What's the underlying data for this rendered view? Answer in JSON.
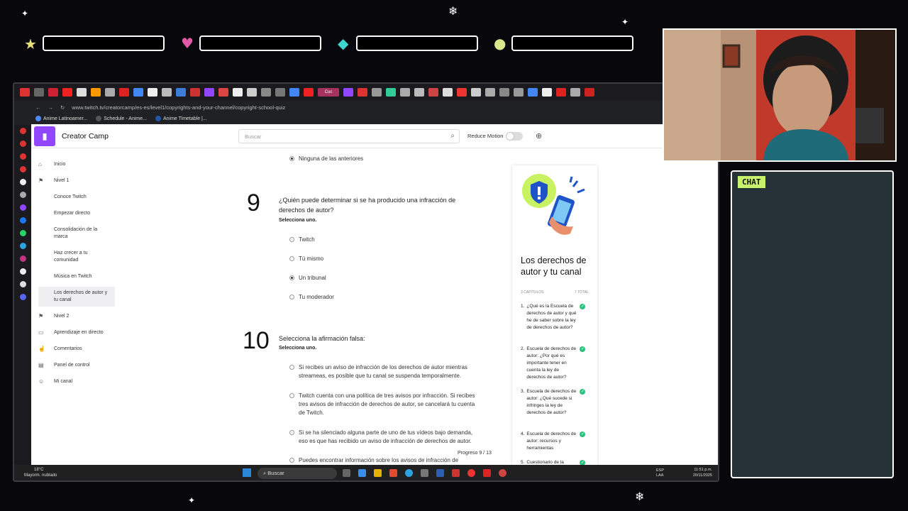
{
  "overlay": {
    "chat_label": "CHAT",
    "icons": [
      "star-icon",
      "heart-icon",
      "diamond-icon",
      "coin-icon"
    ]
  },
  "browser": {
    "url": "www.twitch.tv/creatorcamp/es-es/level1/copyrights-and-your-channel/copyright-school-quiz",
    "active_tab": "Cuc",
    "bookmarks": [
      "Anime Latinoamer...",
      "Schedule - Anime...",
      "Anime Timetable |..."
    ]
  },
  "site": {
    "title": "Creator Camp",
    "search_placeholder": "Buscar",
    "reduce_motion": "Reduce Motion"
  },
  "nav": {
    "items": [
      {
        "label": "Inicio"
      },
      {
        "label": "Nivel 1"
      },
      {
        "label": "Conoce Twitch"
      },
      {
        "label": "Empezar directo"
      },
      {
        "label": "Consolidación de la marca"
      },
      {
        "label": "Haz crecer a tu comunidad"
      },
      {
        "label": "Música en Twitch"
      },
      {
        "label": "Los derechos de autor y tu canal"
      },
      {
        "label": "Nivel 2"
      },
      {
        "label": "Aprendizaje en directo"
      },
      {
        "label": "Comentarios"
      },
      {
        "label": "Panel de control"
      },
      {
        "label": "Mi canal"
      }
    ]
  },
  "quiz": {
    "prev_option": "Ninguna de las anteriores",
    "q9": {
      "number": "9",
      "text": "¿Quién puede determinar si se ha producido una infracción de derechos de autor?",
      "hint": "Selecciona uno.",
      "options": [
        "Twitch",
        "Tú mismo",
        "Un tribunal",
        "Tu moderador"
      ],
      "selected_index": 2
    },
    "q10": {
      "number": "10",
      "text": "Selecciona la afirmación falsa:",
      "hint": "Selecciona uno.",
      "options": [
        "Si recibes un aviso de infracción de los derechos de autor mientras streameas, es posible que tu canal se suspenda temporalmente.",
        "Twitch cuenta con una política de tres avisos por infracción. Si recibes tres avisos de infracción de derechos de autor, se cancelará tu cuenta de Twitch.",
        "Si se ha silenciado alguna parte de uno de tus vídeos bajo demanda, eso es que has recibido un aviso de infracción de derechos de autor.",
        "Puedes encontrar información sobre los avisos de infracción de"
      ]
    },
    "progress": "Progreso 9 / 13"
  },
  "course_card": {
    "title": "Los derechos de autor y tu canal",
    "chapters_meta": "3 CAPÍTULOS",
    "total_meta": "7 TOTAL",
    "items": [
      {
        "num": "1.",
        "text": "¿Qué es la Escuela de derechos de autor y qué he de saber sobre la ley de derechos de autor?"
      },
      {
        "num": "2.",
        "text": "Escuela de derechos de autor: ¿Por qué es importante tener en cuenta la ley de derechos de autor?"
      },
      {
        "num": "3.",
        "text": "Escuela de derechos de autor: ¿Qué sucede si infringes la ley de derechos de autor?"
      },
      {
        "num": "4.",
        "text": "Escuela de derechos de autor: recursos y herramientas"
      },
      {
        "num": "5.",
        "text": "Cuestionario de la"
      }
    ]
  },
  "taskbar": {
    "temp": "18°C",
    "weather": "Mayorm. nublado",
    "search": "Buscar",
    "lang1": "ESP",
    "lang2": "LAA",
    "time": "11:51 p.m.",
    "date": "20/11/2025"
  },
  "colors": {
    "brand": "#9146ff",
    "check": "#28c47e",
    "chat_label_bg": "#c8f26e",
    "chat_bg": "#263238"
  }
}
